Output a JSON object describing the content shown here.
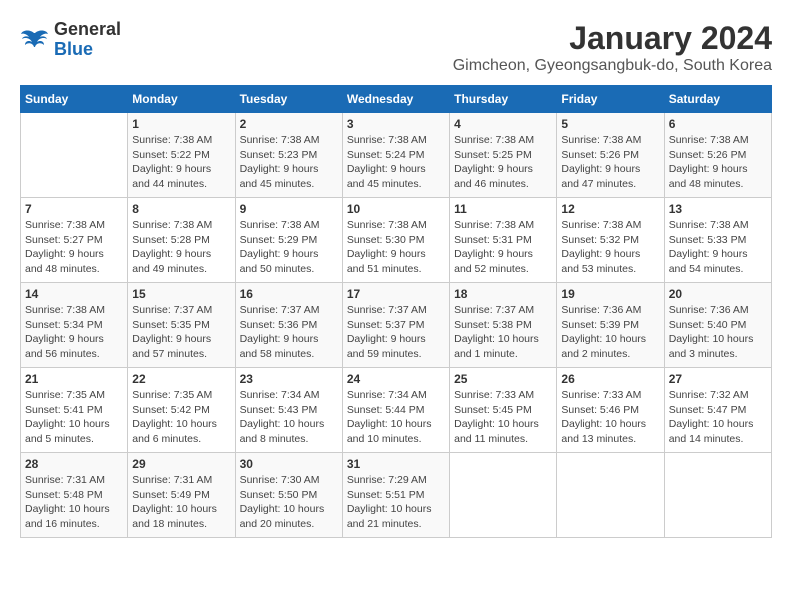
{
  "logo": {
    "line1": "General",
    "line2": "Blue"
  },
  "title": "January 2024",
  "subtitle": "Gimcheon, Gyeongsangbuk-do, South Korea",
  "days_header": [
    "Sunday",
    "Monday",
    "Tuesday",
    "Wednesday",
    "Thursday",
    "Friday",
    "Saturday"
  ],
  "weeks": [
    [
      {
        "day": "",
        "sunrise": "",
        "sunset": "",
        "daylight": ""
      },
      {
        "day": "1",
        "sunrise": "Sunrise: 7:38 AM",
        "sunset": "Sunset: 5:22 PM",
        "daylight": "Daylight: 9 hours and 44 minutes."
      },
      {
        "day": "2",
        "sunrise": "Sunrise: 7:38 AM",
        "sunset": "Sunset: 5:23 PM",
        "daylight": "Daylight: 9 hours and 45 minutes."
      },
      {
        "day": "3",
        "sunrise": "Sunrise: 7:38 AM",
        "sunset": "Sunset: 5:24 PM",
        "daylight": "Daylight: 9 hours and 45 minutes."
      },
      {
        "day": "4",
        "sunrise": "Sunrise: 7:38 AM",
        "sunset": "Sunset: 5:25 PM",
        "daylight": "Daylight: 9 hours and 46 minutes."
      },
      {
        "day": "5",
        "sunrise": "Sunrise: 7:38 AM",
        "sunset": "Sunset: 5:26 PM",
        "daylight": "Daylight: 9 hours and 47 minutes."
      },
      {
        "day": "6",
        "sunrise": "Sunrise: 7:38 AM",
        "sunset": "Sunset: 5:26 PM",
        "daylight": "Daylight: 9 hours and 48 minutes."
      }
    ],
    [
      {
        "day": "7",
        "sunrise": "Sunrise: 7:38 AM",
        "sunset": "Sunset: 5:27 PM",
        "daylight": "Daylight: 9 hours and 48 minutes."
      },
      {
        "day": "8",
        "sunrise": "Sunrise: 7:38 AM",
        "sunset": "Sunset: 5:28 PM",
        "daylight": "Daylight: 9 hours and 49 minutes."
      },
      {
        "day": "9",
        "sunrise": "Sunrise: 7:38 AM",
        "sunset": "Sunset: 5:29 PM",
        "daylight": "Daylight: 9 hours and 50 minutes."
      },
      {
        "day": "10",
        "sunrise": "Sunrise: 7:38 AM",
        "sunset": "Sunset: 5:30 PM",
        "daylight": "Daylight: 9 hours and 51 minutes."
      },
      {
        "day": "11",
        "sunrise": "Sunrise: 7:38 AM",
        "sunset": "Sunset: 5:31 PM",
        "daylight": "Daylight: 9 hours and 52 minutes."
      },
      {
        "day": "12",
        "sunrise": "Sunrise: 7:38 AM",
        "sunset": "Sunset: 5:32 PM",
        "daylight": "Daylight: 9 hours and 53 minutes."
      },
      {
        "day": "13",
        "sunrise": "Sunrise: 7:38 AM",
        "sunset": "Sunset: 5:33 PM",
        "daylight": "Daylight: 9 hours and 54 minutes."
      }
    ],
    [
      {
        "day": "14",
        "sunrise": "Sunrise: 7:38 AM",
        "sunset": "Sunset: 5:34 PM",
        "daylight": "Daylight: 9 hours and 56 minutes."
      },
      {
        "day": "15",
        "sunrise": "Sunrise: 7:37 AM",
        "sunset": "Sunset: 5:35 PM",
        "daylight": "Daylight: 9 hours and 57 minutes."
      },
      {
        "day": "16",
        "sunrise": "Sunrise: 7:37 AM",
        "sunset": "Sunset: 5:36 PM",
        "daylight": "Daylight: 9 hours and 58 minutes."
      },
      {
        "day": "17",
        "sunrise": "Sunrise: 7:37 AM",
        "sunset": "Sunset: 5:37 PM",
        "daylight": "Daylight: 9 hours and 59 minutes."
      },
      {
        "day": "18",
        "sunrise": "Sunrise: 7:37 AM",
        "sunset": "Sunset: 5:38 PM",
        "daylight": "Daylight: 10 hours and 1 minute."
      },
      {
        "day": "19",
        "sunrise": "Sunrise: 7:36 AM",
        "sunset": "Sunset: 5:39 PM",
        "daylight": "Daylight: 10 hours and 2 minutes."
      },
      {
        "day": "20",
        "sunrise": "Sunrise: 7:36 AM",
        "sunset": "Sunset: 5:40 PM",
        "daylight": "Daylight: 10 hours and 3 minutes."
      }
    ],
    [
      {
        "day": "21",
        "sunrise": "Sunrise: 7:35 AM",
        "sunset": "Sunset: 5:41 PM",
        "daylight": "Daylight: 10 hours and 5 minutes."
      },
      {
        "day": "22",
        "sunrise": "Sunrise: 7:35 AM",
        "sunset": "Sunset: 5:42 PM",
        "daylight": "Daylight: 10 hours and 6 minutes."
      },
      {
        "day": "23",
        "sunrise": "Sunrise: 7:34 AM",
        "sunset": "Sunset: 5:43 PM",
        "daylight": "Daylight: 10 hours and 8 minutes."
      },
      {
        "day": "24",
        "sunrise": "Sunrise: 7:34 AM",
        "sunset": "Sunset: 5:44 PM",
        "daylight": "Daylight: 10 hours and 10 minutes."
      },
      {
        "day": "25",
        "sunrise": "Sunrise: 7:33 AM",
        "sunset": "Sunset: 5:45 PM",
        "daylight": "Daylight: 10 hours and 11 minutes."
      },
      {
        "day": "26",
        "sunrise": "Sunrise: 7:33 AM",
        "sunset": "Sunset: 5:46 PM",
        "daylight": "Daylight: 10 hours and 13 minutes."
      },
      {
        "day": "27",
        "sunrise": "Sunrise: 7:32 AM",
        "sunset": "Sunset: 5:47 PM",
        "daylight": "Daylight: 10 hours and 14 minutes."
      }
    ],
    [
      {
        "day": "28",
        "sunrise": "Sunrise: 7:31 AM",
        "sunset": "Sunset: 5:48 PM",
        "daylight": "Daylight: 10 hours and 16 minutes."
      },
      {
        "day": "29",
        "sunrise": "Sunrise: 7:31 AM",
        "sunset": "Sunset: 5:49 PM",
        "daylight": "Daylight: 10 hours and 18 minutes."
      },
      {
        "day": "30",
        "sunrise": "Sunrise: 7:30 AM",
        "sunset": "Sunset: 5:50 PM",
        "daylight": "Daylight: 10 hours and 20 minutes."
      },
      {
        "day": "31",
        "sunrise": "Sunrise: 7:29 AM",
        "sunset": "Sunset: 5:51 PM",
        "daylight": "Daylight: 10 hours and 21 minutes."
      },
      {
        "day": "",
        "sunrise": "",
        "sunset": "",
        "daylight": ""
      },
      {
        "day": "",
        "sunrise": "",
        "sunset": "",
        "daylight": ""
      },
      {
        "day": "",
        "sunrise": "",
        "sunset": "",
        "daylight": ""
      }
    ]
  ]
}
